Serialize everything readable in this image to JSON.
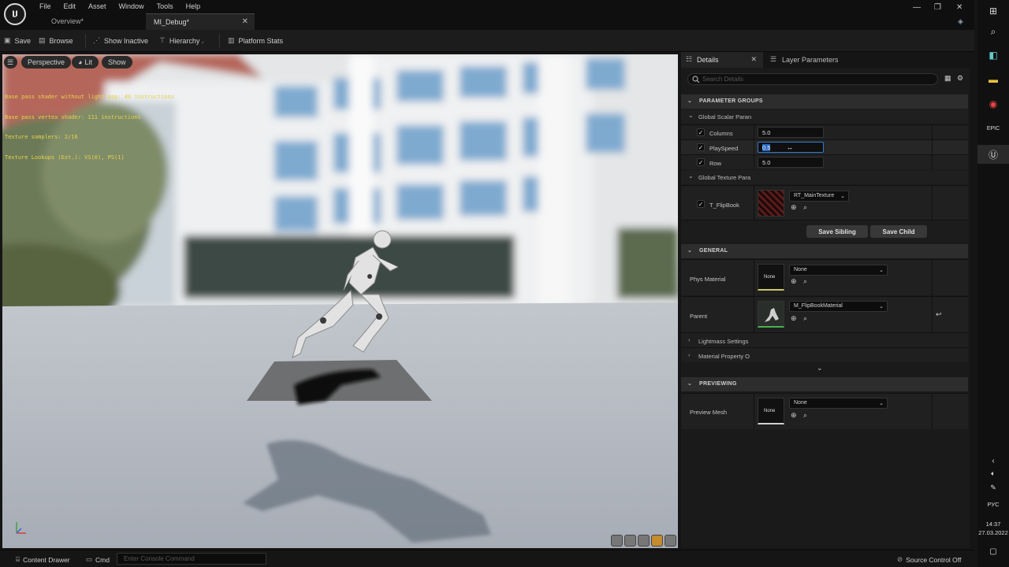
{
  "menu": [
    "File",
    "Edit",
    "Asset",
    "Window",
    "Tools",
    "Help"
  ],
  "tabs": {
    "overview": "Overview*",
    "current": "MI_Debug*"
  },
  "toolbar": {
    "save": "Save",
    "browse": "Browse",
    "show_inactive": "Show Inactive",
    "hierarchy": "Hierarchy",
    "platform_stats": "Platform Stats"
  },
  "viewport": {
    "perspective": "Perspective",
    "lit": "Lit",
    "show": "Show",
    "stats": [
      "Base pass shader without light map: 40 instructions",
      "Base pass vertex shader: 111 instructions",
      "Texture samplers: 2/16",
      "Texture Lookups (Est.): VS(0), PS(1)"
    ]
  },
  "details": {
    "tab_details": "Details",
    "tab_layer": "Layer Parameters",
    "search_placeholder": "Search Details",
    "param_groups": "PARAMETER GROUPS",
    "scalar_group": "Global Scalar Paran",
    "params": [
      {
        "label": "Columns",
        "value": "5.0"
      },
      {
        "label": "PlaySpeed",
        "value": "0.5"
      },
      {
        "label": "Row",
        "value": "5.0"
      }
    ],
    "texture_group": "Global Texture Para",
    "texture_param": {
      "label": "T_FlipBook",
      "value": "RT_MainTexture"
    },
    "save_sibling": "Save Sibling",
    "save_child": "Save Child",
    "general": "GENERAL",
    "phys_material": {
      "label": "Phys Material",
      "thumb": "None",
      "value": "None"
    },
    "parent": {
      "label": "Parent",
      "value": "M_FlipBookMaterial"
    },
    "lightmass": "Lightmass Settings",
    "material_property": "Material Property O",
    "previewing": "PREVIEWING",
    "preview_mesh": {
      "label": "Preview Mesh",
      "thumb": "None",
      "value": "None"
    }
  },
  "bottom": {
    "content_drawer": "Content Drawer",
    "cmd": "Cmd",
    "console_placeholder": "Enter Console Command",
    "source_control": "Source Control Off"
  },
  "taskbar": {
    "lang": "РУС",
    "time": "14:37",
    "date": "27.03.2022"
  }
}
